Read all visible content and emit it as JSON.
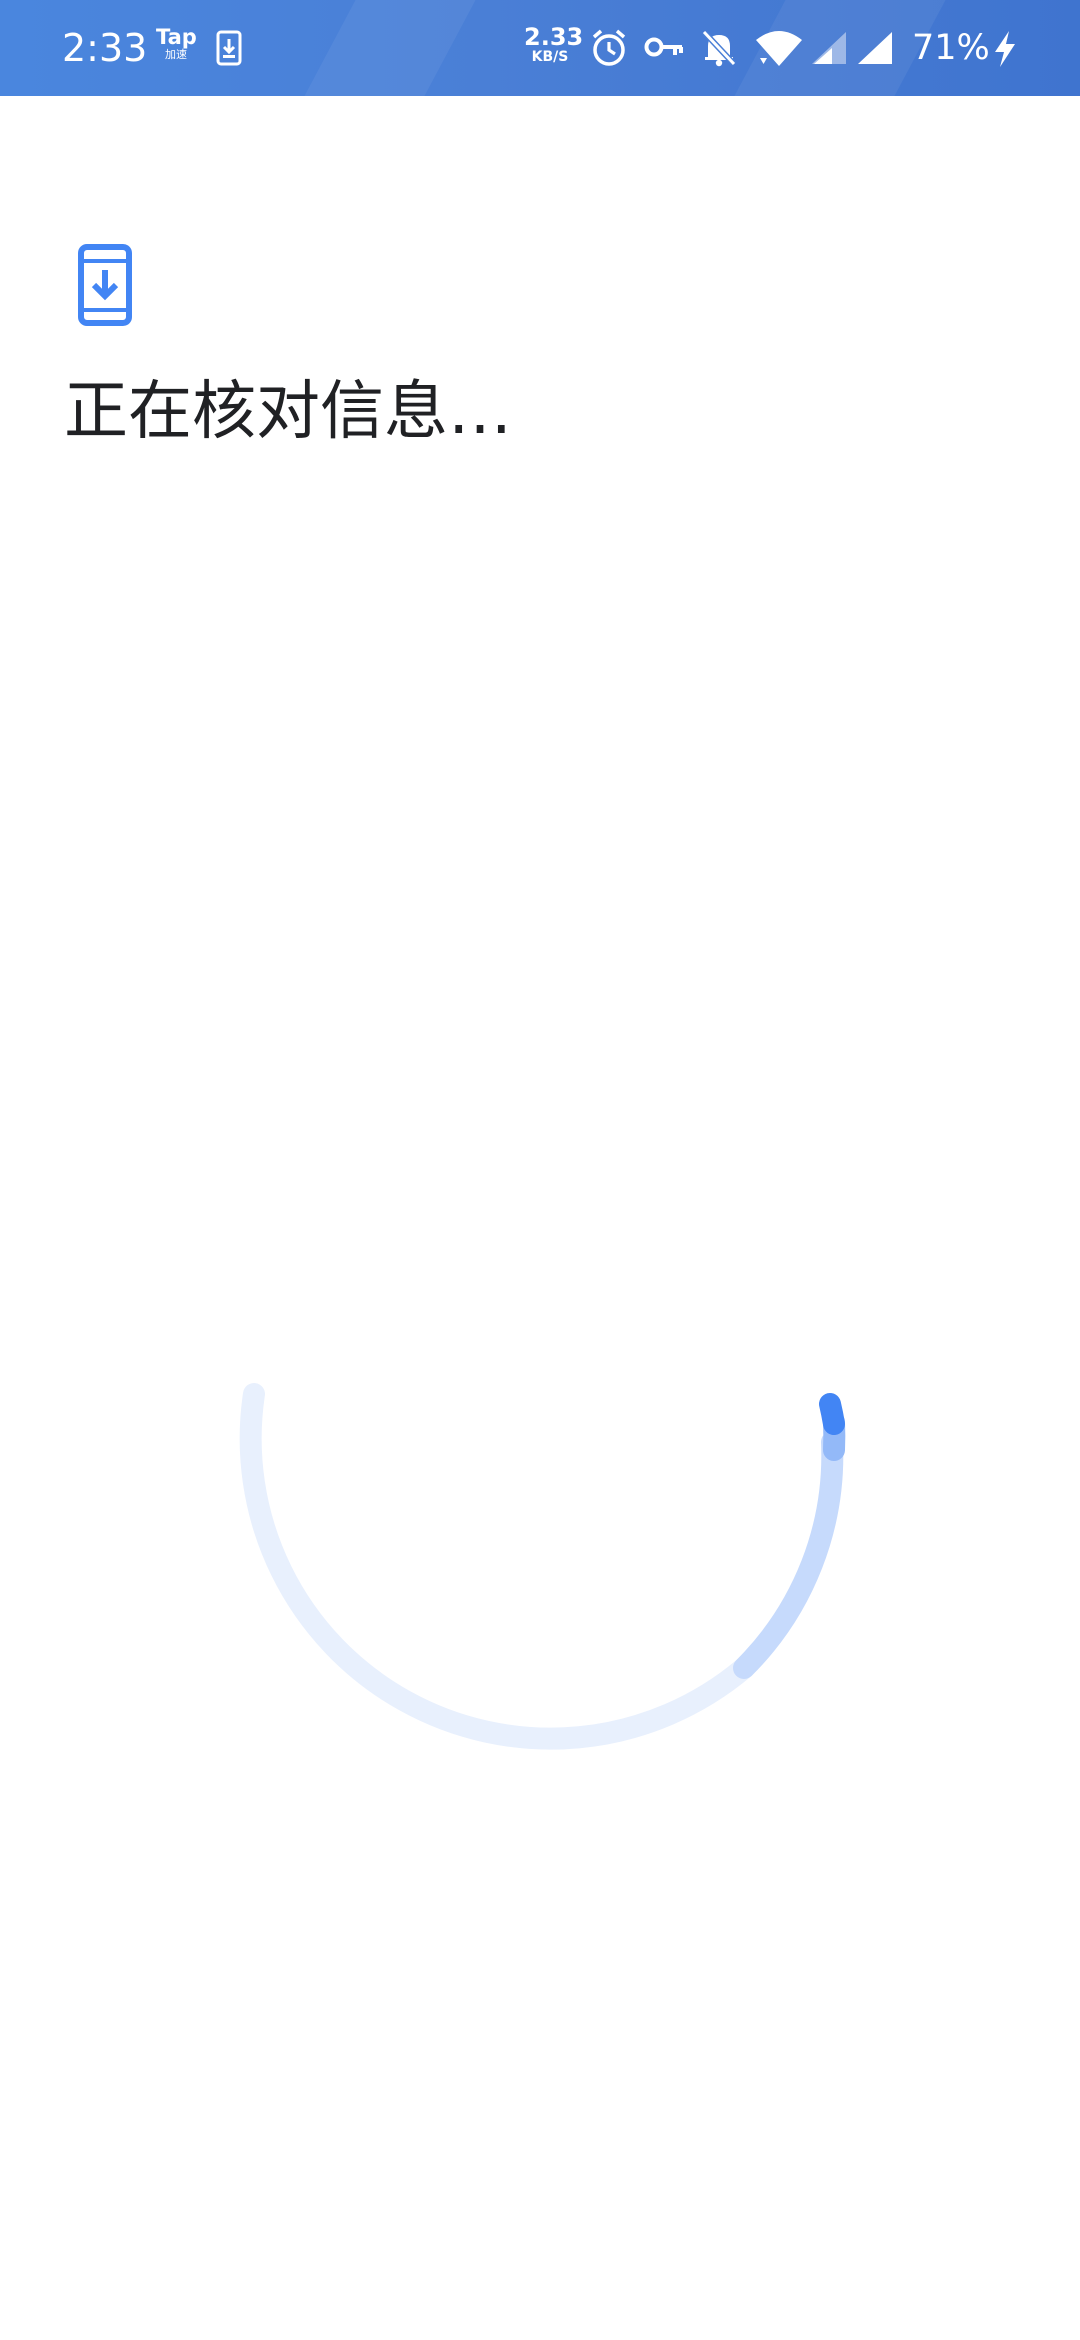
{
  "status_bar": {
    "time": "2:33",
    "tap_logo": {
      "main": "Tap",
      "sub": "加速"
    },
    "network_speed": {
      "value": "2.33",
      "unit": "KB/S"
    },
    "battery": "71%",
    "icons": [
      "download-notification-icon",
      "alarm-icon",
      "vpn-key-icon",
      "bell-muted-icon",
      "wifi-icon",
      "cellular-signal-icon",
      "charging-bolt-icon"
    ],
    "colors": {
      "background": "#4a80d8",
      "foreground": "#ffffff"
    }
  },
  "main": {
    "icon": "phone-download-icon",
    "title": "正在核对信息…",
    "accent_color": "#4285f4",
    "spinner": {
      "track_color": "#e8f0fd",
      "mid_color": "#c6dafc",
      "head_color": "#4285f4"
    }
  }
}
